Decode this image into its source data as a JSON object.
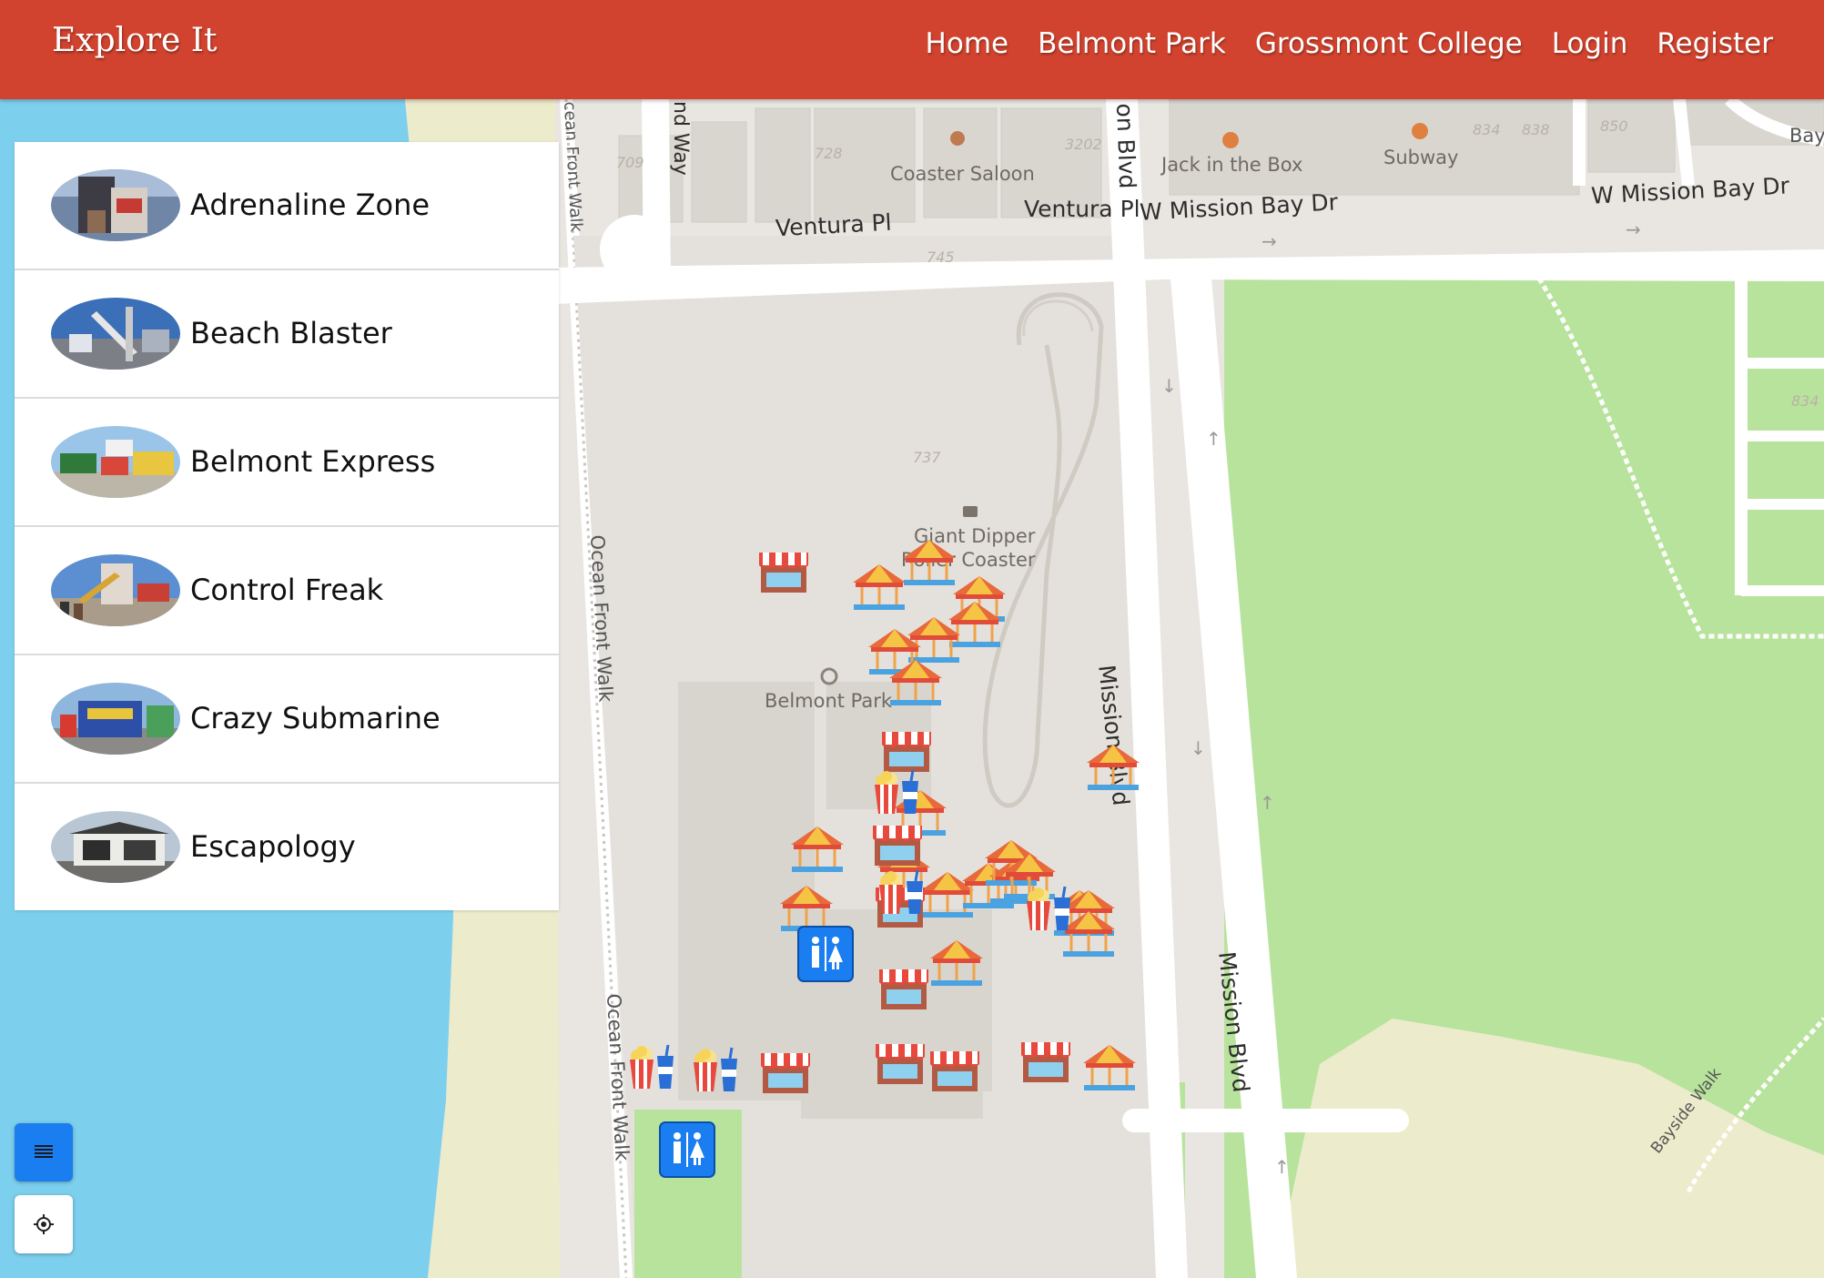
{
  "header": {
    "brand": "Explore It",
    "nav": [
      "Home",
      "Belmont Park",
      "Grossmont College",
      "Login",
      "Register"
    ]
  },
  "attractions": [
    {
      "name": "Adrenaline Zone"
    },
    {
      "name": "Beach Blaster"
    },
    {
      "name": "Belmont Express"
    },
    {
      "name": "Control Freak"
    },
    {
      "name": "Crazy Submarine"
    },
    {
      "name": "Escapology"
    }
  ],
  "map": {
    "places": [
      "Coaster Saloon",
      "Jack in the Box",
      "Subway",
      "Giant Dipper",
      "Roller Coaster",
      "Belmont Park"
    ],
    "roads": [
      "Ventura Pl",
      "Ventura Pl",
      "W Mission Bay Dr",
      "W Mission Bay Dr",
      "Mission Blvd",
      "Mission Blvd",
      "Ocean Front Walk",
      "Ocean Front Walk",
      "cean Front Walk",
      "nd Way",
      "on Blvd",
      "Bayside Walk",
      "Bay"
    ],
    "numbers": [
      "709",
      "728",
      "3202",
      "745",
      "737",
      "834",
      "838",
      "850",
      "834"
    ]
  },
  "controls": {
    "list_icon": "list-icon",
    "locate_icon": "locate-icon"
  },
  "colors": {
    "header": "#d1432e",
    "water": "#7dcfee",
    "park": "#b8e39c",
    "sand": "#ecebcb",
    "button": "#1a7ef0"
  }
}
